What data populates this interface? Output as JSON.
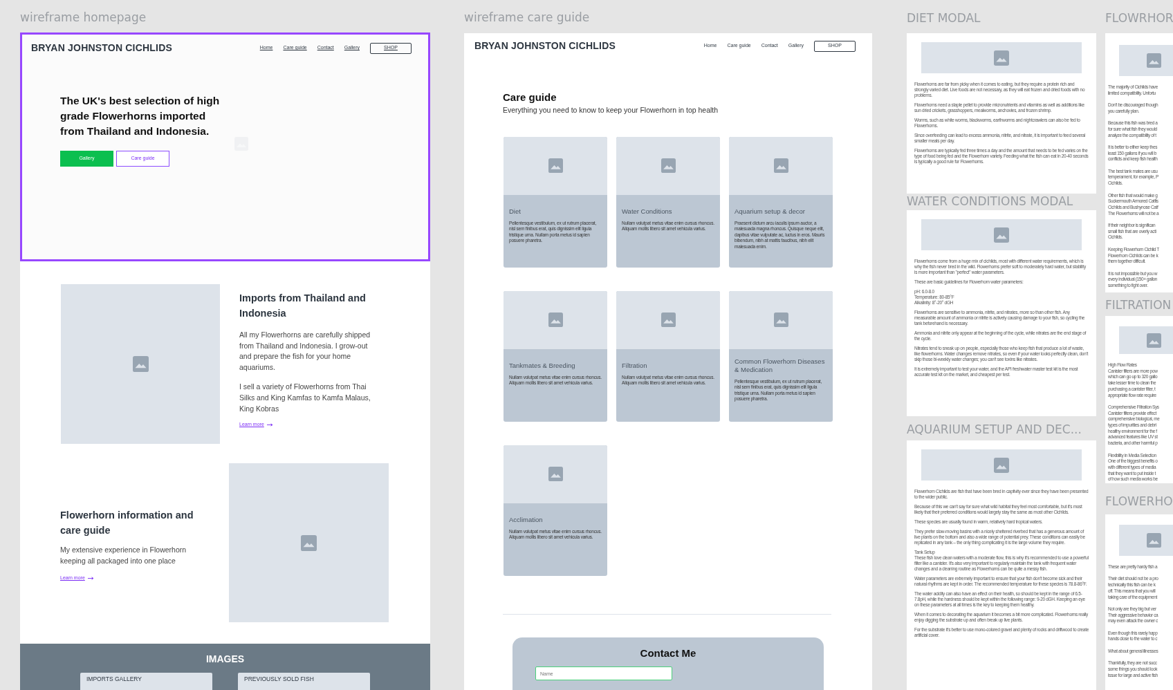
{
  "homepage": {
    "label": "wireframe homepage",
    "selected": true,
    "header": {
      "logo": "BRYAN JOHNSTON CICHLIDS",
      "nav": [
        "Home",
        "Care guide",
        "Contact",
        "Gallery"
      ],
      "shop": "SHOP"
    },
    "hero": {
      "heading": "The UK's best selection of high grade Flowerhorns imported from Thailand and Indonesia.",
      "buttons": [
        {
          "label": "Gallery",
          "kind": "primary"
        },
        {
          "label": "Care guide",
          "kind": "outline"
        }
      ]
    },
    "sections": [
      {
        "heading": "Imports from Thailand and Indonesia",
        "paragraphs": [
          "All my Flowerhorns are carefully shipped from Thailand and Indonesia.  I grow-out and prepare the fish for your home aquariums.",
          "I sell a variety of Flowerhorns from Thai Silks and King Kamfas to Kamfa Malaus, King Kobras"
        ],
        "link": "Learn more"
      },
      {
        "heading": "Flowerhorn information and care guide",
        "paragraphs": [
          "My extensive experience in Flowerhorn keeping all packaged into one place"
        ],
        "link": "Learn more"
      }
    ],
    "images_section": {
      "title": "IMAGES",
      "cards": [
        "IMPORTS GALLERY",
        "PREVIOUSLY SOLD FISH"
      ]
    }
  },
  "care_guide": {
    "label": "wireframe care guide",
    "header": {
      "logo": "BRYAN JOHNSTON CICHLIDS",
      "nav": [
        "Home",
        "Care guide",
        "Contact",
        "Gallery"
      ],
      "shop": "SHOP"
    },
    "title": "Care guide",
    "subtitle": "Everything you need to know to keep your Flowerhorn in top health",
    "cards": [
      {
        "title": "Diet",
        "body": "Pellentesque vestibulum, ex ut rutrum placerat, nisl sem finibus erat, quis dignissim elit ligula tristique urna. Nullam porta metus id sapien posuere pharetra."
      },
      {
        "title": "Water Conditions",
        "body": "Nullam volutpat metus vitae enim cursus rhoncus. Aliquam mollis libero sit amet vehicula varius."
      },
      {
        "title": "Aquarium setup & decor",
        "body": "Praesent dictum arcu iaculis ipsum auctor, a malesuada magna rhoncus. Quisque neque elit, dapibus vitae vulputate ac, luctus in eros. Mauris bibendum, nibh at mattis faucibus, nibh elit malesuada enim."
      },
      {
        "title": "Tankmates & Breeding",
        "body": "Nullam volutpat metus vitae enim cursus rhoncus. Aliquam mollis libero sit amet vehicula varius."
      },
      {
        "title": "Filtration",
        "body": "Nullam volutpat metus vitae enim cursus rhoncus. Aliquam mollis libero sit amet vehicula varius."
      },
      {
        "title": "Common Flowerhorn Diseases & Medication",
        "body": "Pellentesque vestibulum, ex ut rutrum placerat, nisl sem finibus erat, quis dignissim elit ligula tristique urna. Nullam porta metus id sapien posuere pharetra."
      },
      {
        "title": "Acclimation",
        "body": "Nullam volutpat metus vitae enim cursus rhoncus. Aliquam mollis libero sit amet vehicula varius."
      }
    ],
    "contact": {
      "title": "Contact Me",
      "placeholder": "Name"
    }
  },
  "modals": [
    {
      "label": "DIET MODAL",
      "paragraphs": [
        [
          "Flowerhorns are far from picky when it comes to eating, but they require a protein rich and strongly varied diet. Live foods are not necessary, as they will eat frozen and dried foods with no problems."
        ],
        [
          "Flowerhorns need a staple pellet to provide micronutrients and vitamins as well as additions like sun dried crickets, grasshoppers, mealworms, anchovies, and frozen shrimp."
        ],
        [
          "Worms, such as white worms, blackworms, earthworms and nightcrawlers can also be fed to Flowerhorns."
        ],
        [
          "Since overfeeding can lead to excess ammonia, nitrite, and nitrate, it is important to feed several smaller meals per day."
        ],
        [
          "Flowerhorns are typically fed three times a day and the amount that needs to be fed varies on the type of food being fed and the Flowerhorn variety. Feeding what the fish can eat in 20-40 seconds is typically a good rule for Flowerhorns."
        ]
      ]
    },
    {
      "label": "WATER CONDITIONS MODAL",
      "paragraphs": [
        [
          "Flowerhorns come from a huge mix of cichlids, most with different water requirements, which is why the fish never bred in the wild. Flowerhorns prefer soft to moderately hard water, but stability is more important than \"perfect\" water parameters."
        ],
        [
          "These are basic guidelines for Flowerhorn water parameters:"
        ],
        [
          "pH: 6.0-8.0",
          "Temperature: 80-85°F",
          "Alkalinity: 8°-20° dGH"
        ],
        [
          "Flowerhorns are sensitive to ammonia, nitrite, and nitrates, more so than other fish. Any measurable amount of ammonia or nitrite is actively causing damage to your fish, so cycling the tank beforehand is necessary."
        ],
        [
          "Ammonia and nitrite only appear at the beginning of the cycle, while nitrates are the end stage of the cycle."
        ],
        [
          "Nitrates tend to sneak up on people, especially those who keep fish that produce a lot of waste, like flowerhorns. Water changes remove nitrates, so even if your water looks perfectly clean, don't skip those bi-weekly water changes; you can't see toxins like nitrates."
        ],
        [
          "It is extremely important to test your water, and the API freshwater master test kit is the most accurate test kit on the market, and cheapest per test."
        ]
      ]
    },
    {
      "label": "AQUARIUM SETUP AND DEC...",
      "paragraphs": [
        [
          "Flowerhorn Cichlids are fish that have been bred in captivity ever since they have been presented to the wider public."
        ],
        [
          "Because of this we can't say for sure what wild habitat they feel most comfortable, but it's most likely that their preferred conditions would largely stay the same as most other Cichlids."
        ],
        [
          "These species are usually found in warm, relatively hard tropical waters."
        ],
        [
          "They prefer slow-moving basins with a nicely sheltered riverbed that has a generous amount of live plants on the bottom and also a wide range of potential prey. These conditions can easily be replicated in any tank – the only thing complicating it is the large volume they require."
        ],
        [
          "Tank Setup",
          "These fish love clean waters with a moderate flow, this is why it's recommended to use a powerful filter like a canister. It's also very important to regularly maintain the tank with frequent water changes and a cleaning routine as Flowerhorns can be quite a messy fish."
        ],
        [
          "Water parameters are extremely important to ensure that your fish don't become sick and their natural rhythms are kept in order. The recommended temperature for these species is 78.8-86°F."
        ],
        [
          "The water acidity can also have an effect on their health, so should be kept in the range of 6.5-7.8pH, while the hardness should be kept within the following range: 9-20 dGH. Keeping an eye on these parameters at all times is the key to keeping them healthy."
        ],
        [
          "When it comes to decorating the aquarium it becomes a bit more complicated. Flowerhorns really enjoy digging the substrate up and often break up live plants."
        ],
        [
          "For the substrate it's better to use mono-colored gravel and plenty of rocks and driftwood to create artificial cover."
        ]
      ]
    }
  ],
  "modals_cut_off": [
    {
      "label": "FLOWRHOR",
      "paragraphs": [
        [
          "The majority of Cichlids have",
          "limited compatibility. Unfortu"
        ],
        [
          "Don't be discouraged though",
          "you carefully plan."
        ],
        [
          "Because this fish was bred a",
          "for sure what fish they would",
          "analyze the compatibility of t"
        ],
        [
          "It is better to either keep thes",
          "least 150 gallons if you will b",
          "conflicts and keep fish health"
        ],
        [
          "The best tank mates are usu",
          "temperament, for example, P",
          "Cichlids."
        ],
        [
          "Other fish that would make g",
          "Suckermouth Armored Catfis",
          "Cichlids and Bushynose Catf",
          "The Flowerhorns will not be a"
        ],
        [
          "If their neighbor is significan",
          "small fish that are overly acti",
          "Cichlids."
        ],
        [
          "Keeping Flowerhorn Cichlid T",
          "Flowerhorn Cichlids can be k",
          "them together difficult."
        ],
        [
          "It is not impossible but you w",
          "every individual (150+ gallon",
          "something to fight over."
        ]
      ]
    },
    {
      "label": "FILTRATION",
      "paragraphs": [
        [
          "High Flow Rates",
          "Canister filters are more pow",
          "which can go up to 320 gallo",
          "take lesser time to clean the",
          "purchasing a canister filter, t",
          "appropriate flow rate require"
        ],
        [
          "Comprehensive Filtration Sys",
          "Canister filters provide effect",
          "comprehensive biological, me",
          "types of impurities and debri",
          "healthy environment for the f",
          "advanced features like UV st",
          "bacteria, and other harmful p"
        ],
        [
          "Flexibility in Media Selection",
          "One of the biggest benefits o",
          "with different types of media",
          "that they want to put inside t",
          "of how such media works be"
        ]
      ]
    },
    {
      "label": "FLOWERHO",
      "paragraphs": [
        [
          "These are pretty hardy fish a"
        ],
        [
          "Their diet should not be a pro",
          "technically this fish can be k",
          "off. This means that you will",
          "taking care of the equipment"
        ],
        [
          "Not only are they big but ver",
          "Their aggressive behavior ca",
          "may even attack the owner c"
        ],
        [
          "Even though this rarely happ",
          "hands close to the water to c"
        ],
        [
          "What about general illnesses"
        ],
        [
          "Thankfully, they are not succ",
          "some things you should look",
          "issue for large and active fish"
        ]
      ]
    }
  ]
}
